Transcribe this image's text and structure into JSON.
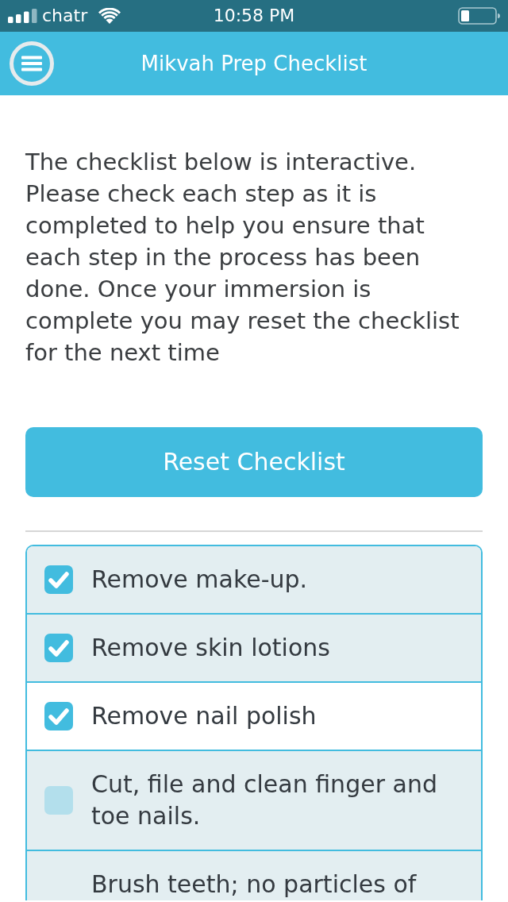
{
  "status_bar": {
    "carrier": "chatr",
    "time": "10:58 PM"
  },
  "nav_bar": {
    "title": "Mikvah Prep Checklist"
  },
  "intro": "The checklist below is interactive. Please check each step as it is completed to help you ensure that each step in the process has been done. Once your immersion is complete you may reset the checklist for the next time",
  "reset_button": {
    "label": "Reset Checklist"
  },
  "checklist": [
    {
      "label": "Remove make-up.",
      "checked": true,
      "selected": false
    },
    {
      "label": "Remove skin lotions",
      "checked": true,
      "selected": false
    },
    {
      "label": "Remove nail polish",
      "checked": true,
      "selected": true
    },
    {
      "label": "Cut, file and clean finger and toe nails.",
      "checked": false,
      "selected": false
    },
    {
      "label": "Brush teeth; no particles of",
      "selected": false
    }
  ]
}
